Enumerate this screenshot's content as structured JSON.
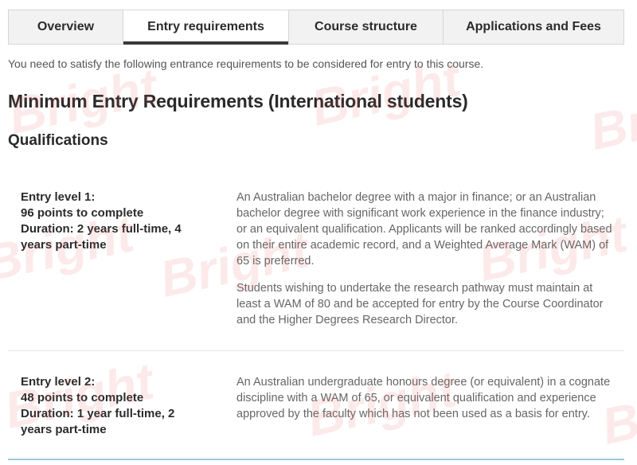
{
  "tabs": [
    {
      "label": "Overview",
      "active": false
    },
    {
      "label": "Entry requirements",
      "active": true
    },
    {
      "label": "Course structure",
      "active": false
    },
    {
      "label": "Applications and Fees",
      "active": false
    }
  ],
  "intro": "You need to satisfy the following entrance requirements to be considered for entry to this course.",
  "heading": "Minimum Entry Requirements (International students)",
  "subheading": "Qualifications",
  "entries": [
    {
      "lines": [
        "Entry level 1:",
        "96 points to complete",
        "Duration: 2 years full-time, 4",
        "years part-time"
      ],
      "paragraphs": [
        "An Australian bachelor degree with a major in finance; or an Australian bachelor degree with significant work experience in the finance industry; or an equivalent qualification. Applicants will be ranked accordingly based on their entire academic record, and a Weighted Average Mark (WAM) of 65 is preferred.",
        "Students wishing to undertake the research pathway must maintain at least a WAM of 80 and be accepted for entry by the Course Coordinator and the Higher Degrees Research Director."
      ]
    },
    {
      "lines": [
        "Entry level 2:",
        "48 points to complete",
        "Duration: 1 year full-time, 2",
        "years part-time"
      ],
      "paragraphs": [
        "An Australian undergraduate honours degree (or equivalent) in a cognate discipline with a WAM of 65, or equivalent qualification and experience approved by the faculty which has not been used as a basis for entry."
      ]
    }
  ],
  "watermark": "Bright",
  "colors": {
    "tab_bg": "#f2f2f2",
    "active_underline": "#3a3a3a",
    "watermark": "#e65a5a",
    "bottom_rule": "#9fc8d8"
  }
}
